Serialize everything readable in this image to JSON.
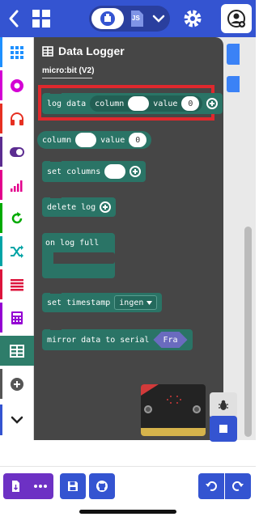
{
  "toolbar": {
    "back": "back-icon",
    "home": "home-icon",
    "mode_toggle": {
      "blocks_icon": "puzzle-icon",
      "js_label": "JS",
      "dropdown_icon": "chevron-down-icon"
    },
    "settings": "gear-icon",
    "user": "user-add-icon"
  },
  "categories": [
    {
      "name": "Basic",
      "icon": "grid-icon",
      "color": "#1e90ff"
    },
    {
      "name": "Input",
      "icon": "target-icon",
      "color": "#d400d4"
    },
    {
      "name": "Music",
      "icon": "headphones-icon",
      "color": "#e63022"
    },
    {
      "name": "Led",
      "icon": "toggle-icon",
      "color": "#5c2d91"
    },
    {
      "name": "Radio",
      "icon": "signal-bars-icon",
      "color": "#e3008c"
    },
    {
      "name": "Loops",
      "icon": "loop-icon",
      "color": "#00aa00"
    },
    {
      "name": "Logic",
      "icon": "shuffle-icon",
      "color": "#00a4a6"
    },
    {
      "name": "Variables",
      "icon": "list-icon",
      "color": "#dc143c"
    },
    {
      "name": "Math",
      "icon": "calculator-icon",
      "color": "#9400d3"
    },
    {
      "name": "Data Logger",
      "icon": "table-icon",
      "color": "#2e7d6a",
      "selected": true
    },
    {
      "name": "Extensions",
      "icon": "plus-circle-icon",
      "color": "#555555"
    }
  ],
  "flyout": {
    "title": "Data Logger",
    "title_icon": "table-icon",
    "section": "micro:bit (V2)",
    "blocks": {
      "log_data": {
        "label": "log data",
        "column": "column",
        "value": "value",
        "value_default": "0"
      },
      "column_value": {
        "column": "column",
        "value": "value",
        "value_default": "0"
      },
      "set_columns": "set columns",
      "delete_log": "delete log",
      "on_log_full": "on log full",
      "set_timestamp": {
        "label": "set timestamp",
        "option": "ingen"
      },
      "mirror_serial": {
        "label": "mirror data to serial",
        "option": "Fra"
      }
    }
  },
  "simulator": {
    "debug_icon": "bug-icon",
    "stop_icon": "stop-icon"
  },
  "sidebar_expand": "chevron-down-icon",
  "bottom": {
    "download_icon": "download-file-icon",
    "more_icon": "more-dots-icon",
    "save_icon": "save-icon",
    "github_icon": "github-icon",
    "undo_icon": "undo-icon",
    "redo_icon": "redo-icon"
  },
  "colors": {
    "brand_blue": "#3454d1",
    "download_purple": "#6d31c4",
    "block_teal": "#2a7466",
    "flyout_bg": "#464646",
    "highlight_red": "#e0282d"
  }
}
